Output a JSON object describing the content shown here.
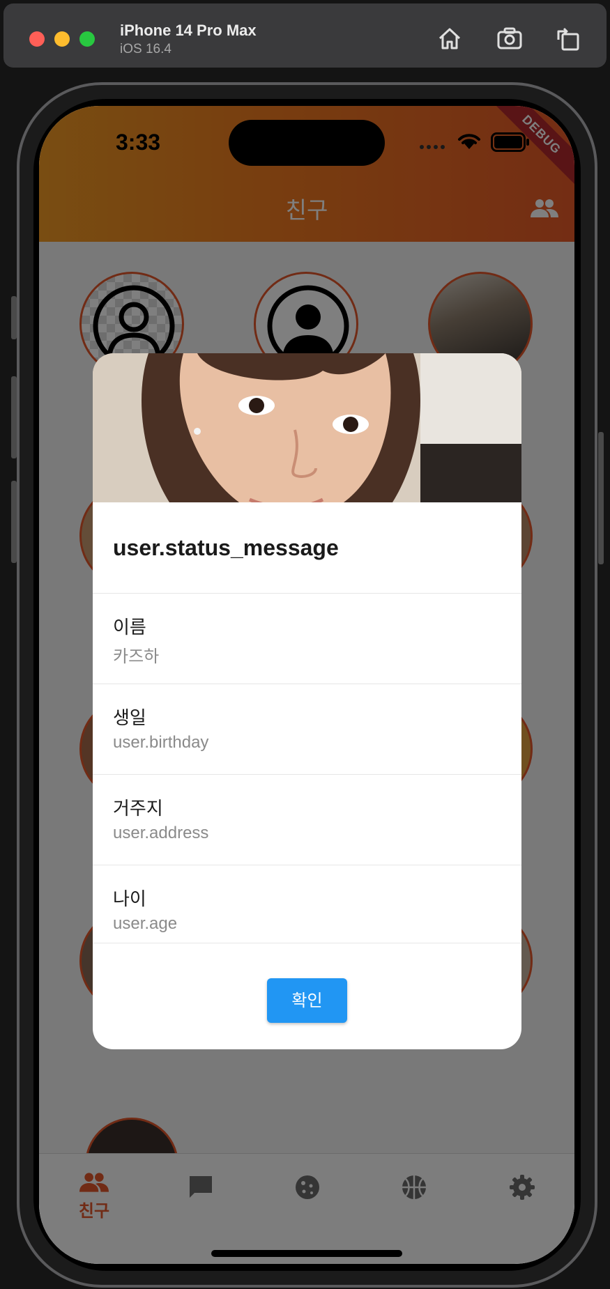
{
  "simulator": {
    "device_name": "iPhone 14 Pro Max",
    "os_version": "iOS 16.4",
    "icons": [
      "home-icon",
      "screenshot-icon",
      "rotate-icon"
    ]
  },
  "status_bar": {
    "time": "3:33",
    "icons": [
      "signal-icon",
      "wifi-icon",
      "battery-icon"
    ]
  },
  "debug_banner": "DEBUG",
  "app_bar": {
    "title": "친구",
    "action_icon": "people-icon"
  },
  "dialog": {
    "title": "user.status_message",
    "rows": [
      {
        "label": "이름",
        "value": "카즈하"
      },
      {
        "label": "생일",
        "value": "user.birthday"
      },
      {
        "label": "거주지",
        "value": "user.address"
      },
      {
        "label": "나이",
        "value": "user.age"
      }
    ],
    "confirm_label": "확인"
  },
  "bottom_nav": {
    "items": [
      {
        "icon": "people-icon",
        "label": "친구",
        "active": true
      },
      {
        "icon": "chat-icon",
        "label": ""
      },
      {
        "icon": "cookie-icon",
        "label": ""
      },
      {
        "icon": "basketball-icon",
        "label": ""
      },
      {
        "icon": "settings-icon",
        "label": ""
      }
    ]
  },
  "colors": {
    "appbar_start": "#f29b24",
    "appbar_end": "#e85a28",
    "accent": "#e3562a",
    "confirm_button": "#2196f3",
    "debug_banner": "#b3282d"
  }
}
